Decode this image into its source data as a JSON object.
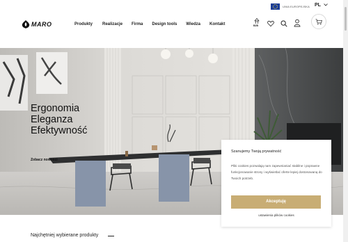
{
  "header": {
    "eu_label": "UNIA EUROPEJSKA",
    "language": "PL",
    "logo_text": "MARO",
    "nav": [
      {
        "label": "Produkty",
        "name": "nav-produkty"
      },
      {
        "label": "Realizacje",
        "name": "nav-realizacje"
      },
      {
        "label": "Firma",
        "name": "nav-firma"
      },
      {
        "label": "Design tools",
        "name": "nav-design-tools"
      },
      {
        "label": "Wiedza",
        "name": "nav-wiedza"
      },
      {
        "label": "Kontakt",
        "name": "nav-kontakt"
      }
    ],
    "b2b_label": "B2B"
  },
  "hero": {
    "lines": [
      "Ergonomia",
      "Eleganza",
      "Efektywność"
    ],
    "link": "Zobacz nowości"
  },
  "bottom": {
    "popular": "Najchętniej wybierane produkty"
  },
  "cookie": {
    "title": "Szanujemy Twoją prywatność",
    "text": "Pliki cookies pozwalają nam zapewnianiać stabilne i poprawne funkcjonowanie strony i wyświetlać oferte lepiej dostosowaną do Twoich potrzeb.",
    "accept": "Akceptuję",
    "settings": "ustawienia plików cookies"
  },
  "colors": {
    "accent": "#c8ad74",
    "eu_flag": "#1a3d99"
  }
}
